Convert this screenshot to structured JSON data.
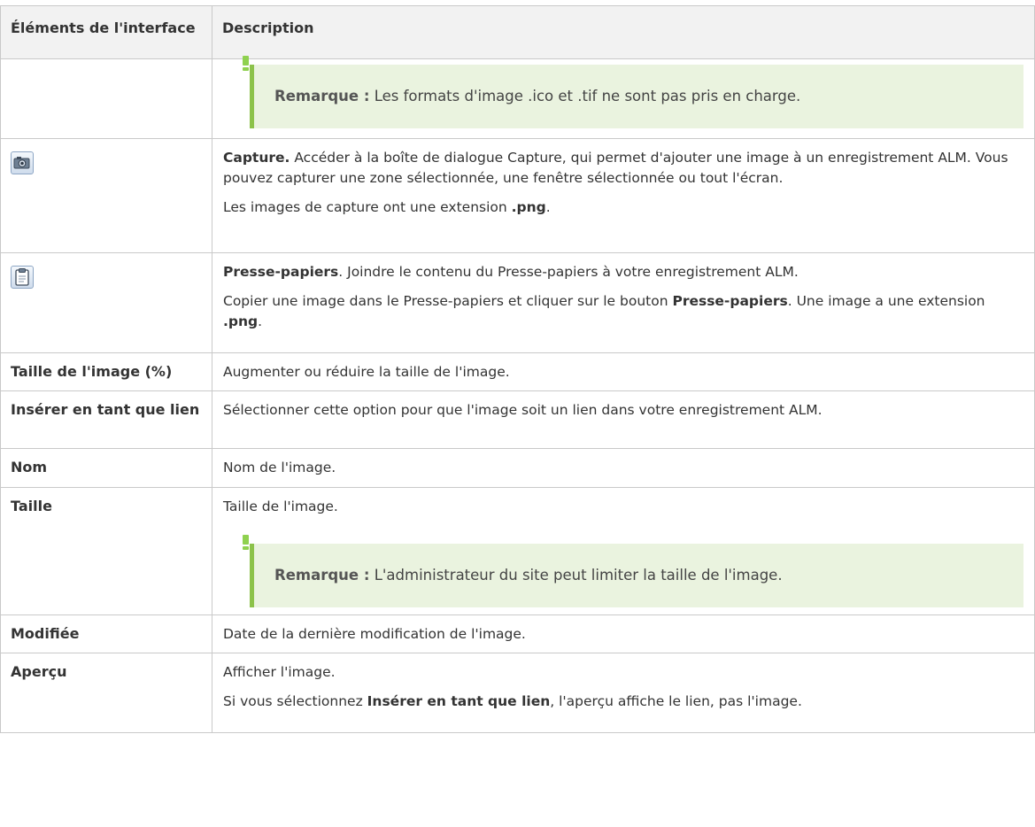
{
  "header": {
    "col1": "Éléments de l'interface",
    "col2": "Description"
  },
  "notes": {
    "label": "Remarque :",
    "formats": "Les formats d'image .ico et .tif ne sont pas pris en charge.",
    "size_limit": "L'administrateur du site peut limiter la taille de l'image."
  },
  "icons": {
    "capture": "camera-icon",
    "clipboard": "clipboard-icon"
  },
  "rows": {
    "capture": {
      "title": "Capture.",
      "desc": " Accéder à la boîte de dialogue Capture, qui permet d'ajouter une image à un enregistrement ALM. Vous pouvez capturer une zone sélectionnée, une fenêtre sélectionnée ou tout l'écran.",
      "ext_prefix": "Les images de capture ont une extension ",
      "ext": ".png",
      "ext_suffix": "."
    },
    "clipboard": {
      "title": "Presse-papiers",
      "desc": ". Joindre le contenu du Presse-papiers à votre enregistrement ALM.",
      "p2_prefix": "Copier une image dans le Presse-papiers et cliquer sur le bouton ",
      "p2_button": "Presse-papiers",
      "p2_mid": ". Une image a une extension ",
      "p2_ext": ".png",
      "p2_suffix": "."
    },
    "image_size": {
      "label": "Taille de l'image (%)",
      "desc": "Augmenter ou réduire la taille de l'image."
    },
    "insert_link": {
      "label": "Insérer en tant que lien",
      "desc": "Sélectionner cette option pour que l'image soit un lien dans votre enregistrement ALM."
    },
    "name": {
      "label": "Nom",
      "desc": "Nom de l'image."
    },
    "size": {
      "label": "Taille",
      "desc": "Taille de l'image."
    },
    "modified": {
      "label": "Modifiée",
      "desc": "Date de la dernière modification de l'image."
    },
    "preview": {
      "label": "Aperçu",
      "desc": "Afficher l'image.",
      "p2_prefix": "Si vous sélectionnez ",
      "p2_bold": "Insérer en tant que lien",
      "p2_suffix": ", l'aperçu affiche le lien, pas l'image."
    }
  }
}
